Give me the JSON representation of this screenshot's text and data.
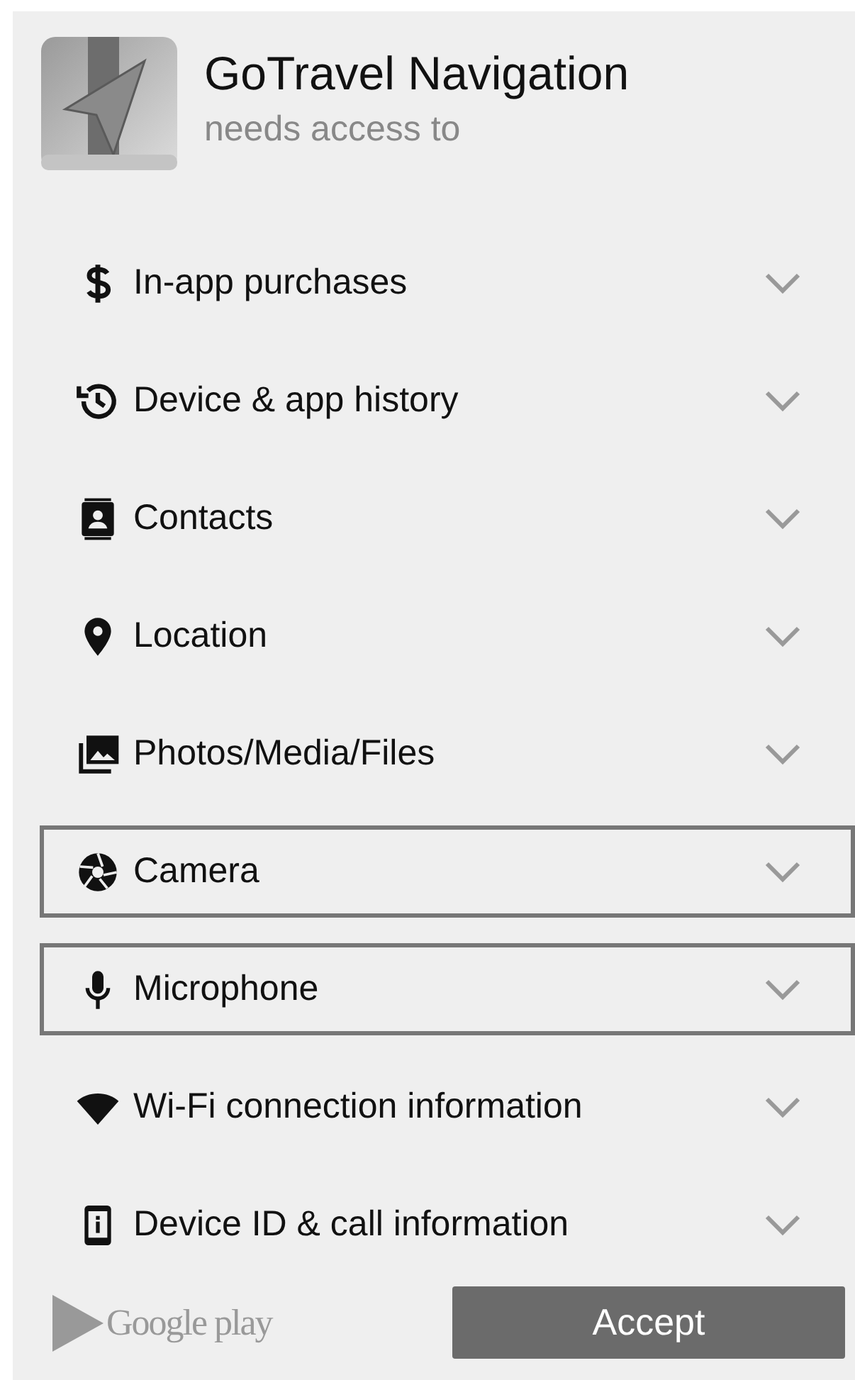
{
  "app": {
    "name": "GoTravel Navigation",
    "subtitle": "needs access to"
  },
  "permissions": [
    {
      "label": "In-app purchases",
      "highlighted": false
    },
    {
      "label": "Device & app history",
      "highlighted": false
    },
    {
      "label": "Contacts",
      "highlighted": false
    },
    {
      "label": "Location",
      "highlighted": false
    },
    {
      "label": "Photos/Media/Files",
      "highlighted": false
    },
    {
      "label": "Camera",
      "highlighted": true
    },
    {
      "label": "Microphone",
      "highlighted": true
    },
    {
      "label": "Wi-Fi connection information",
      "highlighted": false
    },
    {
      "label": "Device ID & call information",
      "highlighted": false
    }
  ],
  "footer": {
    "store": "Google play",
    "button": "Accept"
  }
}
